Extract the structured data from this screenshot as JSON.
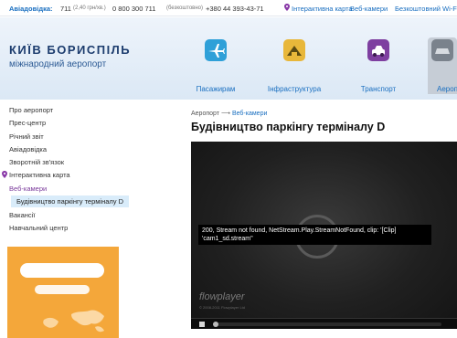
{
  "topbar": {
    "helpline_label": "Авіадовідка:",
    "phone1": "711",
    "phone1_note": "(2,40 грн/хв.)",
    "phone2": "0 800 300 711",
    "phone2_note": "(безкоштовно)",
    "phone3": "+380 44 393-43-71",
    "links": [
      "Інтерактивна карта",
      "Веб-камери",
      "Безкоштовний Wi-Fi"
    ]
  },
  "brand": {
    "title": "КИЇВ БОРИСПІЛЬ",
    "subtitle": "міжнародний аеропорт"
  },
  "nav": [
    {
      "label": "Пасажирам",
      "icon": "airplane-icon",
      "color": "#2fa0d8"
    },
    {
      "label": "Інфраструктура",
      "icon": "building-icon",
      "color": "#e8b73a"
    },
    {
      "label": "Транспорт",
      "icon": "car-icon",
      "color": "#7e3fa0"
    },
    {
      "label": "Аеропорт",
      "icon": "airport-icon",
      "color": "#7a828c"
    }
  ],
  "sidebar": {
    "items": [
      {
        "label": "Про аеропорт"
      },
      {
        "label": "Прес-центр"
      },
      {
        "label": "Річний звіт"
      },
      {
        "label": "Авіадовідка"
      },
      {
        "label": "Зворотній зв'язок"
      },
      {
        "label": "Інтерактивна карта"
      },
      {
        "label": "Веб-камери"
      },
      {
        "label": "Будівництво паркінгу терміналу D"
      },
      {
        "label": "Вакансії"
      },
      {
        "label": "Навчальний центр"
      }
    ]
  },
  "breadcrumb": {
    "home": "Аеропорт",
    "arrow": "⟶",
    "current": "Веб-камери"
  },
  "page": {
    "title": "Будівництво паркінгу терміналу D"
  },
  "player": {
    "error_line1": "200, Stream not found, NetStream.Play.StreamNotFound, clip: '[Clip]",
    "error_line2": "'cam1_sd.stream''",
    "brand": "flowplayer",
    "copyright": "© 2008-2011 Flowplayer Ltd"
  }
}
